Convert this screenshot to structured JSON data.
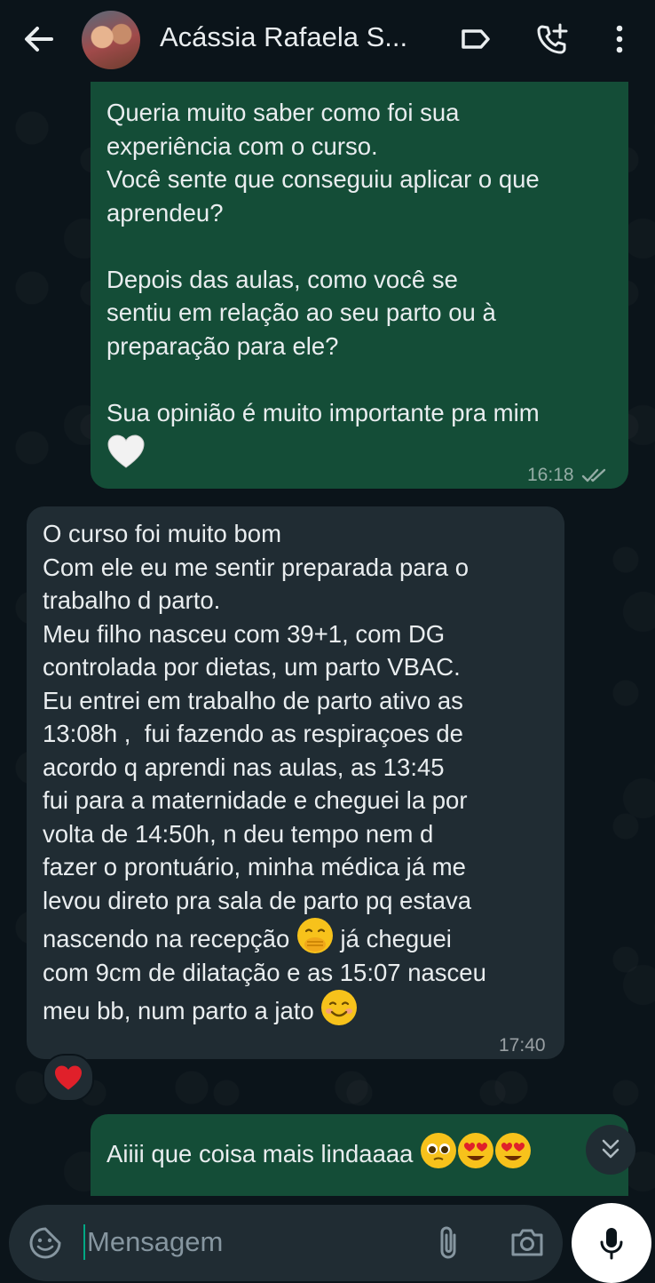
{
  "header": {
    "contact_name": "Acássia Rafaela S...",
    "icons": [
      "back-arrow-icon",
      "avatar",
      "label-icon",
      "add-call-icon",
      "more-vert-icon"
    ]
  },
  "messages": [
    {
      "direction": "outgoing",
      "text": "Queria muito saber como foi sua\nexperiência com o curso.\nVocê sente que conseguiu aplicar o que\naprendeu?\n\nDepois das aulas, como você se\nsentiu em relação ao seu parto ou à\npreparação para ele?\n\nSua opinião é muito importante pra mim",
      "emoji": "white-heart",
      "time": "16:18",
      "status": "read"
    },
    {
      "direction": "incoming",
      "text_part1": "O curso foi muito bom\nCom ele eu me sentir preparada para o\ntrabalho d parto.\nMeu filho nasceu com 39+1, com DG\ncontrolada por dietas, um parto VBAC.\nEu entrei em trabalho de parto ativo as\n13:08h ,  fui fazendo as respiraçoes de\nacordo q aprendi nas aulas, as 13:45\nfui para a maternidade e cheguei la por\nvolta de 14:50h, n deu tempo nem d\nfazer o prontuário, minha médica já me\nlevou direto pra sala de parto pq estava\nnascendo na recepção",
      "text_part2": " já cheguei\ncom 9cm de dilatação e as 15:07 nasceu\nmeu bb, num parto a jato",
      "time": "17:40",
      "reaction": "red-heart"
    },
    {
      "direction": "outgoing",
      "text": "Aiiii que coisa mais lindaaaa"
    }
  ],
  "composer": {
    "placeholder": "Mensagem"
  },
  "colors": {
    "background": "#0b141a",
    "outgoing_bubble": "#144d37",
    "incoming_bubble": "#202c33",
    "accent": "#00a884"
  }
}
